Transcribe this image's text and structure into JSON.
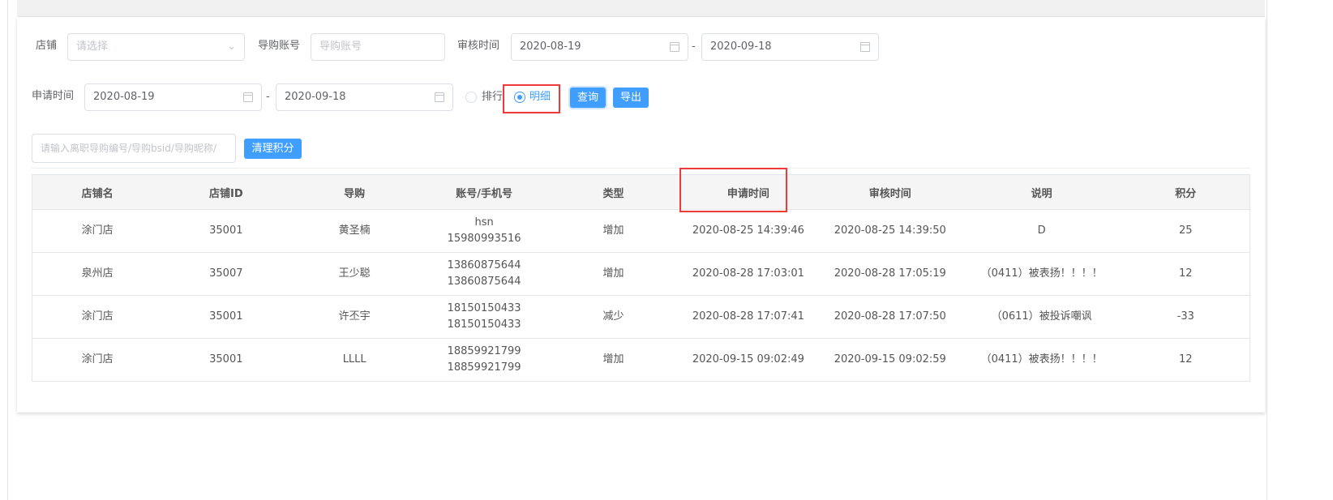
{
  "filters": {
    "store_label": "店铺",
    "store_placeholder": "请选择",
    "guide_account_label": "导购账号",
    "guide_account_placeholder": "导购账号",
    "review_time_label": "审核时间",
    "review_start": "2020-08-19",
    "review_end": "2020-09-18",
    "apply_time_label": "申请时间",
    "apply_start": "2020-08-19",
    "apply_end": "2020-09-18",
    "range_sep": "-",
    "mode_options": [
      {
        "label": "排行",
        "checked": false
      },
      {
        "label": "明细",
        "checked": true
      }
    ],
    "query_button": "查询",
    "export_button": "导出",
    "clear_input_placeholder": "请输入离职导购编号/导购bsid/导购昵称/",
    "clear_points_button": "清理积分"
  },
  "accent_color": "#409eff",
  "highlight_color": "#f03a3a",
  "table": {
    "columns": [
      "店铺名",
      "店铺ID",
      "导购",
      "账号/手机号",
      "类型",
      "申请时间",
      "审核时间",
      "说明",
      "积分"
    ],
    "rows": [
      {
        "store": "涂门店",
        "store_id": "35001",
        "guide": "黄圣楠",
        "account": "hsn",
        "phone": "15980993516",
        "type": "增加",
        "apply_time": "2020-08-25 14:39:46",
        "review_time": "2020-08-25 14:39:50",
        "note": "D",
        "points": "25"
      },
      {
        "store": "泉州店",
        "store_id": "35007",
        "guide": "王少聪",
        "account": "13860875644",
        "phone": "13860875644",
        "type": "增加",
        "apply_time": "2020-08-28 17:03:01",
        "review_time": "2020-08-28 17:05:19",
        "note": "（0411）被表扬！！！！",
        "points": "12"
      },
      {
        "store": "涂门店",
        "store_id": "35001",
        "guide": "许丕宇",
        "account": "18150150433",
        "phone": "18150150433",
        "type": "减少",
        "apply_time": "2020-08-28 17:07:41",
        "review_time": "2020-08-28 17:07:50",
        "note": "（0611）被投诉嘲讽",
        "points": "-33"
      },
      {
        "store": "涂门店",
        "store_id": "35001",
        "guide": "LLLL",
        "account": "18859921799",
        "phone": "18859921799",
        "type": "增加",
        "apply_time": "2020-09-15 09:02:49",
        "review_time": "2020-09-15 09:02:59",
        "note": "（0411）被表扬！！！！",
        "points": "12"
      }
    ]
  }
}
